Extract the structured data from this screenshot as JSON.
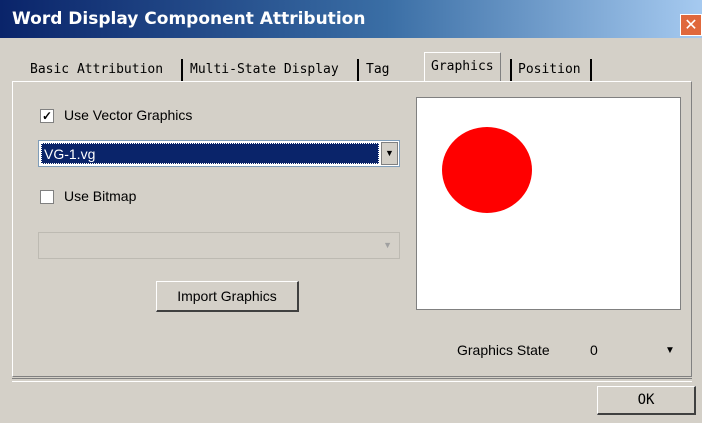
{
  "window": {
    "title": "Word Display Component Attribution",
    "close_glyph": "✕"
  },
  "tabs": [
    {
      "label": "Basic Attribution",
      "active": false
    },
    {
      "label": "Multi-State Display",
      "active": false
    },
    {
      "label": "Tag",
      "active": false
    },
    {
      "label": "Graphics",
      "active": true
    },
    {
      "label": "Position",
      "active": false
    }
  ],
  "graphics": {
    "use_vector": {
      "label": "Use Vector Graphics",
      "checked": true
    },
    "vector_select": {
      "value": "VG-1.vg"
    },
    "use_bitmap": {
      "label": "Use Bitmap",
      "checked": false
    },
    "bitmap_select": {
      "value": ""
    },
    "import_button": "Import Graphics",
    "preview": {
      "shape": "circle",
      "color": "#ff0000"
    },
    "state": {
      "label": "Graphics State",
      "value": "0"
    }
  },
  "footer": {
    "ok_button": "OK"
  },
  "colors": {
    "accent": "#0a246a",
    "dialog_bg": "#d4d0c8",
    "preview_shape": "#ff0000"
  }
}
